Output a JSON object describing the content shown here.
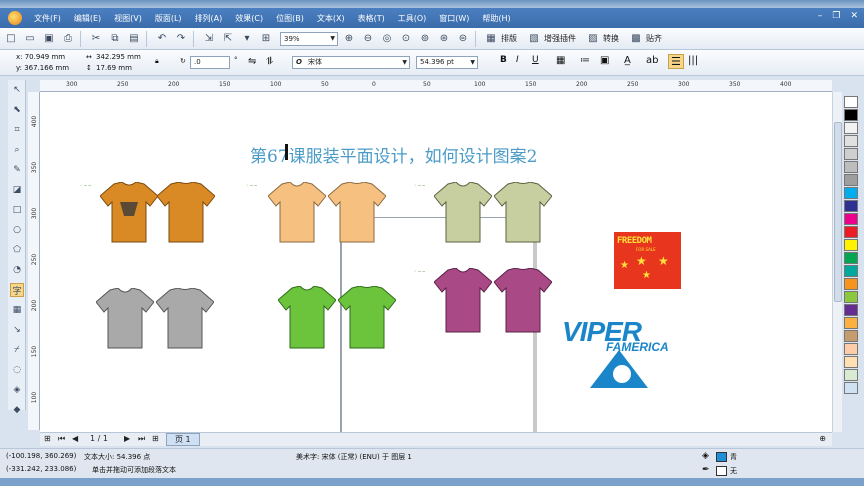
{
  "menubar": {
    "items": [
      "文件(F)",
      "编辑(E)",
      "视图(V)",
      "版面(L)",
      "排列(A)",
      "效果(C)",
      "位图(B)",
      "文本(X)",
      "表格(T)",
      "工具(O)",
      "窗口(W)",
      "帮助(H)"
    ]
  },
  "toolbar": {
    "zoom": "39%",
    "plugins": [
      "排版",
      "增强插件",
      "转换",
      "贴齐"
    ]
  },
  "property_bar": {
    "x": "x: 70.949 mm",
    "y": "y: 367.166 mm",
    "width": "342.295 mm",
    "height": "17.69 mm",
    "rotation": ".0",
    "font": "宋体",
    "font_size": "54.396 pt",
    "degree_sign": "°"
  },
  "ruler": {
    "h_ticks": [
      "300",
      "250",
      "200",
      "150",
      "100",
      "50",
      "0",
      "50",
      "100",
      "150",
      "200",
      "250",
      "300",
      "350",
      "400"
    ],
    "v_ticks": [
      "400",
      "350",
      "300",
      "250",
      "200",
      "150",
      "100"
    ]
  },
  "canvas": {
    "title": "第67课服装平面设计，如何设计图案2",
    "logo_freedom": "FREEDOM",
    "logo_freedom_sub": "FOR SALE",
    "logo_viper": "VIPER",
    "logo_viper_sub": "FAMERICA"
  },
  "pagebar": {
    "page_count": "1 / 1",
    "page_tab": "页 1"
  },
  "status": {
    "coords1": "(-100.198, 360.269)",
    "text_size": "文本大小: 54.396 点",
    "font_info": "美术字: 宋体 (正常) (ENU) 于 图层 1",
    "coords2": "(-331.242, 233.086)",
    "hint": "单击并拖动可添加段落文本",
    "fill_label": "青",
    "outline_label": "无"
  },
  "palette_colors": [
    "#ffffff",
    "#000000",
    "#f2f2f2",
    "#e0e0e0",
    "#cfcfcf",
    "#bdbdbd",
    "#9e9e9e",
    "#00aeef",
    "#2e3192",
    "#ec008c",
    "#ed1c24",
    "#fff200",
    "#00a651",
    "#00a99d",
    "#f7941d",
    "#8dc63f",
    "#662d91",
    "#fbb040",
    "#c69c6d",
    "#ffccaa",
    "#ffe0b2",
    "#d9ead3",
    "#cfe2f3"
  ]
}
